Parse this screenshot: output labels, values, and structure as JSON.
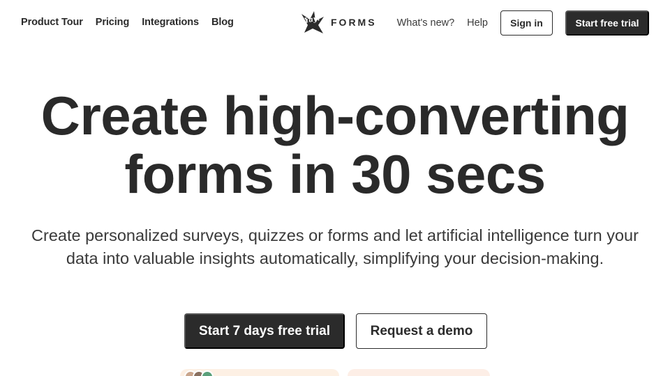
{
  "nav": {
    "links": [
      "Product Tour",
      "Pricing",
      "Integrations",
      "Blog"
    ],
    "whats_new": "What's new?",
    "help": "Help",
    "sign_in": "Sign in",
    "start_trial": "Start free trial"
  },
  "logo": {
    "script": "Yay!",
    "word": "FORMS",
    "icon": "yayforms-logo-icon"
  },
  "hero": {
    "title_line1": "Create high-converting",
    "title_line2": "forms in 30 secs",
    "subtitle_line1": "Create personalized surveys, quizzes or forms and let artificial intelligence turn your",
    "subtitle_line2": "data into valuable insights automatically, simplifying your decision-making.",
    "cta_primary": "Start 7 days free trial",
    "cta_secondary": "Request a demo"
  },
  "colors": {
    "text": "#2b2b2b",
    "button_dark": "#2b2b2b",
    "peek_card_left": "#fdf0e4",
    "peek_card_right": "#fdeee6"
  }
}
